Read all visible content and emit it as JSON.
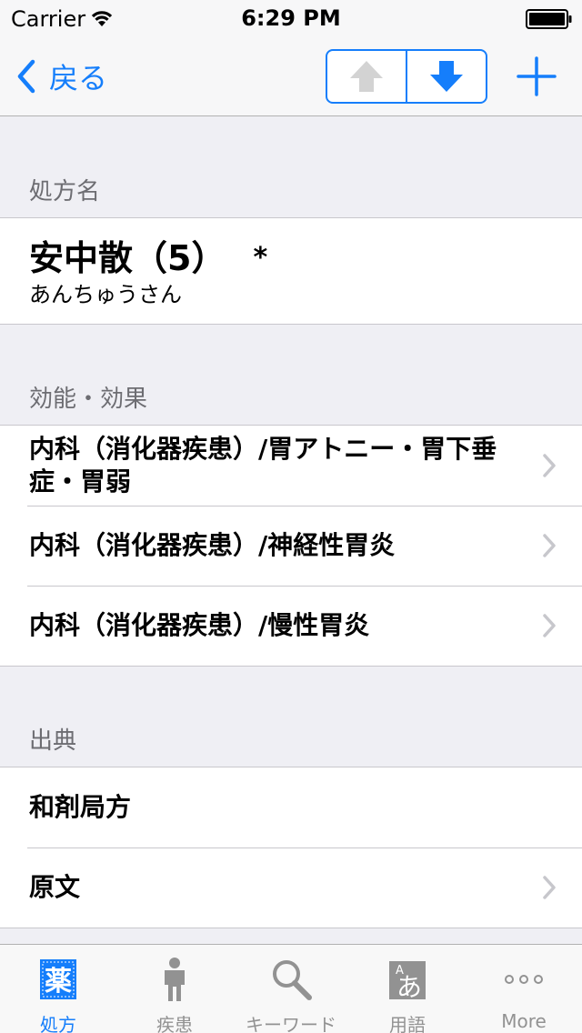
{
  "status": {
    "carrier": "Carrier",
    "time": "6:29 PM"
  },
  "nav": {
    "back_label": "戻る"
  },
  "sections": {
    "name_header": "処方名",
    "effect_header": "効能・効果",
    "source_header": "出典"
  },
  "prescription": {
    "name": "安中散（5）",
    "mark": "*",
    "reading": "あんちゅうさん"
  },
  "effects": [
    {
      "text": "内科（消化器疾患）/胃アトニー・胃下垂症・胃弱"
    },
    {
      "text": "内科（消化器疾患）/神経性胃炎"
    },
    {
      "text": "内科（消化器疾患）/慢性胃炎"
    }
  ],
  "sources": [
    {
      "text": "和剤局方"
    },
    {
      "text": "原文"
    }
  ],
  "tabs": [
    {
      "label": "処方",
      "icon": "medicine-icon",
      "icon_text": "薬"
    },
    {
      "label": "疾患",
      "icon": "person-icon"
    },
    {
      "label": "キーワード",
      "icon": "magnifier-icon"
    },
    {
      "label": "用語",
      "icon": "glossary-icon",
      "icon_text": "あ",
      "icon_small": "A"
    },
    {
      "label": "More",
      "icon": "more-icon"
    }
  ],
  "colors": {
    "accent": "#157efb",
    "tab_inactive": "#929292",
    "background": "#efeff4"
  }
}
